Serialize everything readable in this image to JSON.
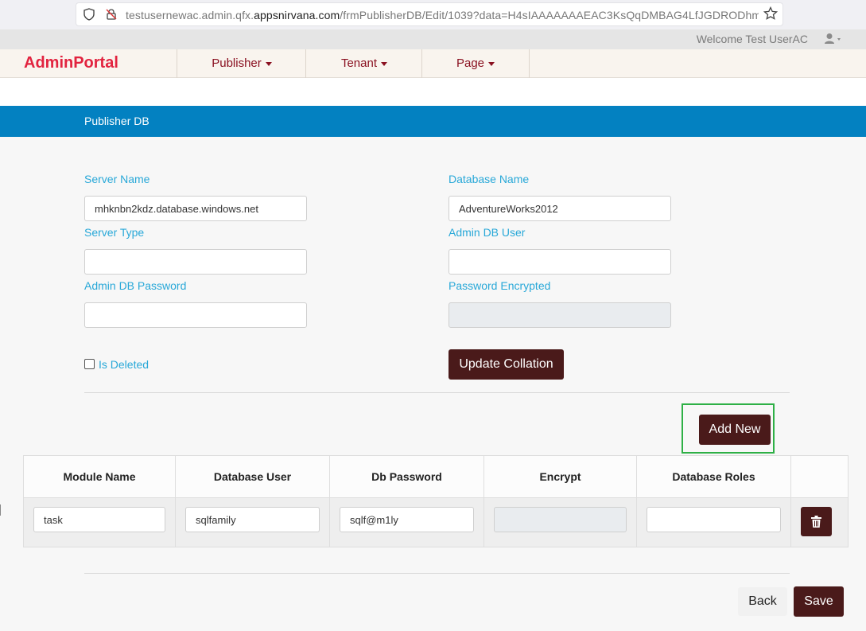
{
  "browser": {
    "url_prefix": "testusernewac.admin.qfx.",
    "url_host": "appsnirvana.com",
    "url_rest": "/frmPublisherDB/Edit/1039?data=H4sIAAAAAAAEAC3KsQqDMBAG4LfJGDRODhmUzKU"
  },
  "welcome": {
    "text": "Welcome Test UserAC"
  },
  "navbar": {
    "brand": "AdminPortal",
    "items": [
      {
        "label": "Publisher"
      },
      {
        "label": "Tenant"
      },
      {
        "label": "Page"
      }
    ]
  },
  "header": {
    "title": "Publisher DB"
  },
  "form": {
    "server_name": {
      "label": "Server Name",
      "value": "mhknbn2kdz.database.windows.net"
    },
    "database_name": {
      "label": "Database Name",
      "value": "AdventureWorks2012"
    },
    "server_type": {
      "label": "Server Type",
      "value": ""
    },
    "admin_db_user": {
      "label": "Admin DB User",
      "value": ""
    },
    "admin_db_password": {
      "label": "Admin DB Password",
      "value": ""
    },
    "password_encrypted": {
      "label": "Password Encrypted",
      "value": ""
    },
    "is_deleted": {
      "label": "Is Deleted",
      "checked": false
    },
    "update_collation_label": "Update Collation",
    "add_new_label": "Add New"
  },
  "table": {
    "headers": [
      "Module Name",
      "Database User",
      "Db Password",
      "Encrypt",
      "Database Roles",
      ""
    ],
    "rows": [
      {
        "module_name": "task",
        "database_user": "sqlfamily",
        "db_password": "sqlf@m1ly",
        "encrypt": "",
        "database_roles": ""
      }
    ]
  },
  "footer": {
    "back_label": "Back",
    "save_label": "Save"
  },
  "colors": {
    "accent_blue": "#0381c1",
    "button_dark": "#4a1a1a",
    "label_blue": "#28a8d8",
    "brand_red": "#e2233f",
    "highlight_green": "#2eb046"
  }
}
